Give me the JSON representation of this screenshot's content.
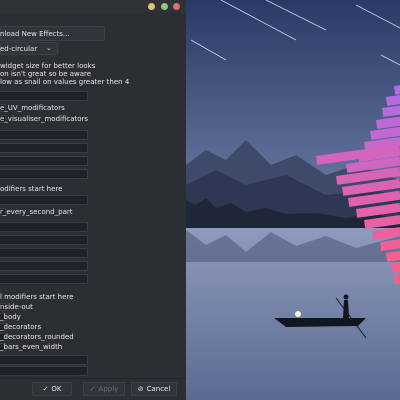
{
  "window": {
    "download_button": "nload New Effects...",
    "preset_value": "ed-circular",
    "note_lines": [
      " widget size for better looks",
      "on isn't great so be aware",
      "low as snail on values greater then 4"
    ],
    "labels": [
      "e_UV_modificators",
      "e_visualiser_modificators",
      "odifiers start here",
      "r_every_second_part",
      "l modifiers start here",
      "nside-out",
      "_body",
      "_decorators",
      "_decorators_rounded",
      "_bars_even_width"
    ],
    "footer": {
      "ok": "OK",
      "apply": "Apply",
      "cancel": "Cancel"
    }
  },
  "icons": {
    "ok": "check-icon",
    "apply": "check-icon",
    "cancel": "cancel-circle-icon",
    "combo": "chevron-down-icon"
  },
  "colors": {
    "window_bg": "#2b2e33",
    "field_bg": "#1f2226",
    "sky_top": "#2a3a66",
    "sky_bottom": "#9aa8c8",
    "bars_top": "#b06ce6",
    "bars_bottom": "#ff5c8a"
  }
}
